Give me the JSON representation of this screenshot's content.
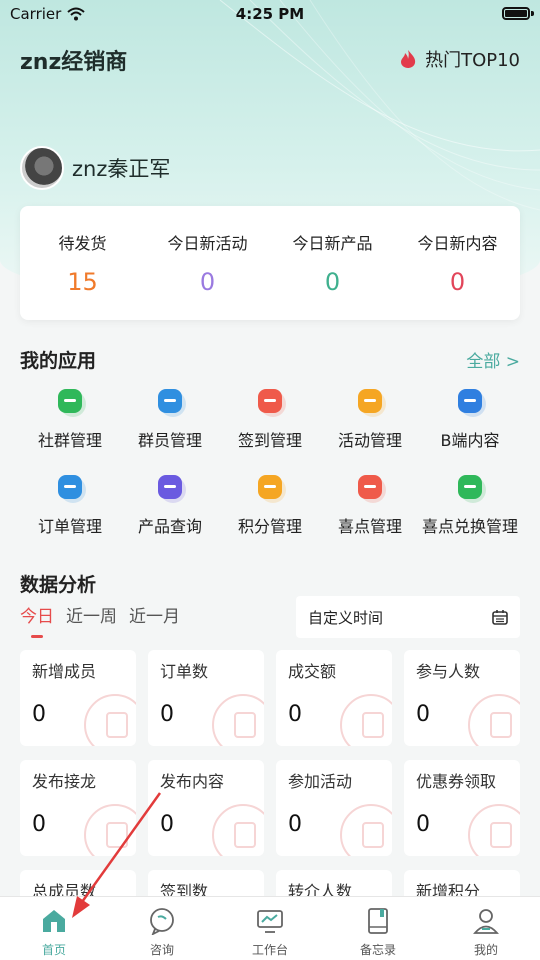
{
  "status_bar": {
    "carrier": "Carrier",
    "time": "4:25 PM"
  },
  "header": {
    "title": "znz经销商",
    "hot_label": "热门TOP10"
  },
  "user": {
    "name": "znz秦正军"
  },
  "stats": [
    {
      "label": "待发货",
      "value": "15",
      "color": "#f07a2b"
    },
    {
      "label": "今日新活动",
      "value": "0",
      "color": "#9a7ae0"
    },
    {
      "label": "今日新产品",
      "value": "0",
      "color": "#3fb08e"
    },
    {
      "label": "今日新内容",
      "value": "0",
      "color": "#e2455a"
    }
  ],
  "apps_section": {
    "title": "我的应用",
    "all_label": "全部 >"
  },
  "apps": [
    {
      "label": "社群管理",
      "icon": "community-icon",
      "color": "#2fb85a"
    },
    {
      "label": "群员管理",
      "icon": "members-icon",
      "color": "#2f8fe0"
    },
    {
      "label": "签到管理",
      "icon": "calendar-check-icon",
      "color": "#ef5a4a"
    },
    {
      "label": "活动管理",
      "icon": "tag-icon",
      "color": "#f5a623"
    },
    {
      "label": "B端内容",
      "icon": "b-badge-icon",
      "color": "#2f7fe0"
    },
    {
      "label": "订单管理",
      "icon": "order-folder-icon",
      "color": "#2f8fe0"
    },
    {
      "label": "产品查询",
      "icon": "product-search-icon",
      "color": "#6a5ae0"
    },
    {
      "label": "积分管理",
      "icon": "money-bag-icon",
      "color": "#f5a623"
    },
    {
      "label": "喜点管理",
      "icon": "diamond-icon",
      "color": "#ef5a4a"
    },
    {
      "label": "喜点兑换管理",
      "icon": "coin-stack-icon",
      "color": "#2fb85a"
    }
  ],
  "analysis": {
    "title": "数据分析",
    "tabs": [
      "今日",
      "近一周",
      "近一月"
    ],
    "active_tab": 0,
    "custom_time_label": "自定义时间"
  },
  "metrics": [
    {
      "label": "新增成员",
      "value": "0",
      "icon": "add-user-icon"
    },
    {
      "label": "订单数",
      "value": "0",
      "icon": "order-icon"
    },
    {
      "label": "成交额",
      "value": "0",
      "icon": "coins-icon"
    },
    {
      "label": "参与人数",
      "value": "0",
      "icon": "people-icon"
    },
    {
      "label": "发布接龙",
      "value": "0",
      "icon": "chain-icon"
    },
    {
      "label": "发布内容",
      "value": "0",
      "icon": "send-icon"
    },
    {
      "label": "参加活动",
      "value": "0",
      "icon": "balloon-icon"
    },
    {
      "label": "优惠券领取",
      "value": "0",
      "icon": "coupon-icon"
    },
    {
      "label": "总成员数",
      "value": "",
      "icon": "group-icon"
    },
    {
      "label": "签到数",
      "value": "",
      "icon": "checkin-icon"
    },
    {
      "label": "转介人数",
      "value": "",
      "icon": "referral-icon"
    },
    {
      "label": "新增积分",
      "value": "",
      "icon": "points-icon"
    }
  ],
  "tabbar": [
    {
      "label": "首页",
      "icon": "home-icon",
      "active": true
    },
    {
      "label": "咨询",
      "icon": "chat-icon",
      "active": false
    },
    {
      "label": "工作台",
      "icon": "monitor-icon",
      "active": false
    },
    {
      "label": "备忘录",
      "icon": "notebook-icon",
      "active": false
    },
    {
      "label": "我的",
      "icon": "profile-icon",
      "active": false
    }
  ],
  "colors": {
    "accent": "#4aaa9f",
    "active_tab": "#e64b4b",
    "annotation_arrow": "#e23b3b"
  }
}
